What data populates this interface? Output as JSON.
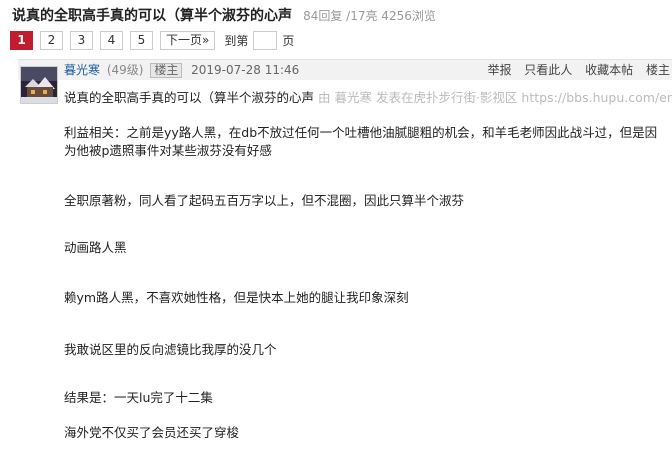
{
  "thread": {
    "title": "说真的全职高手真的可以（算半个淑芬的心声",
    "stats": "84回复 /17亮  4256浏览"
  },
  "pager": {
    "pages": [
      "1",
      "2",
      "3",
      "4",
      "5"
    ],
    "next_label": "下一页»",
    "goto_label": "到第",
    "page_suffix": "页"
  },
  "post": {
    "author": "暮光寒",
    "level": "(49级)",
    "badge": "楼主",
    "date": "2019-07-28 11:46",
    "actions": [
      "举报",
      "只看此人",
      "收藏本帖",
      "楼主"
    ],
    "quote_title": "说真的全职高手真的可以（算半个淑芬的心声",
    "source_text": "由 暮光寒 发表在虎扑步行街·影视区 https://bbs.hupu.com/ent",
    "paragraphs": [
      "利益相关：之前是yy路人黑，在db不放过任何一个吐槽他油腻腿粗的机会，和羊毛老师因此战斗过，但是因为他被p遗照事件对某些淑芬没有好感",
      "全职原著粉，同人看了起码五百万字以上，但不混圈，因此只算半个淑芬",
      "动画路人黑",
      "赖ym路人黑，不喜欢她性格，但是快本上她的腿让我印象深刻",
      "我敢说区里的反向滤镜比我厚的没几个",
      "结果是：一天lu完了十二集",
      "海外党不仅买了会员还买了穿梭"
    ]
  }
}
